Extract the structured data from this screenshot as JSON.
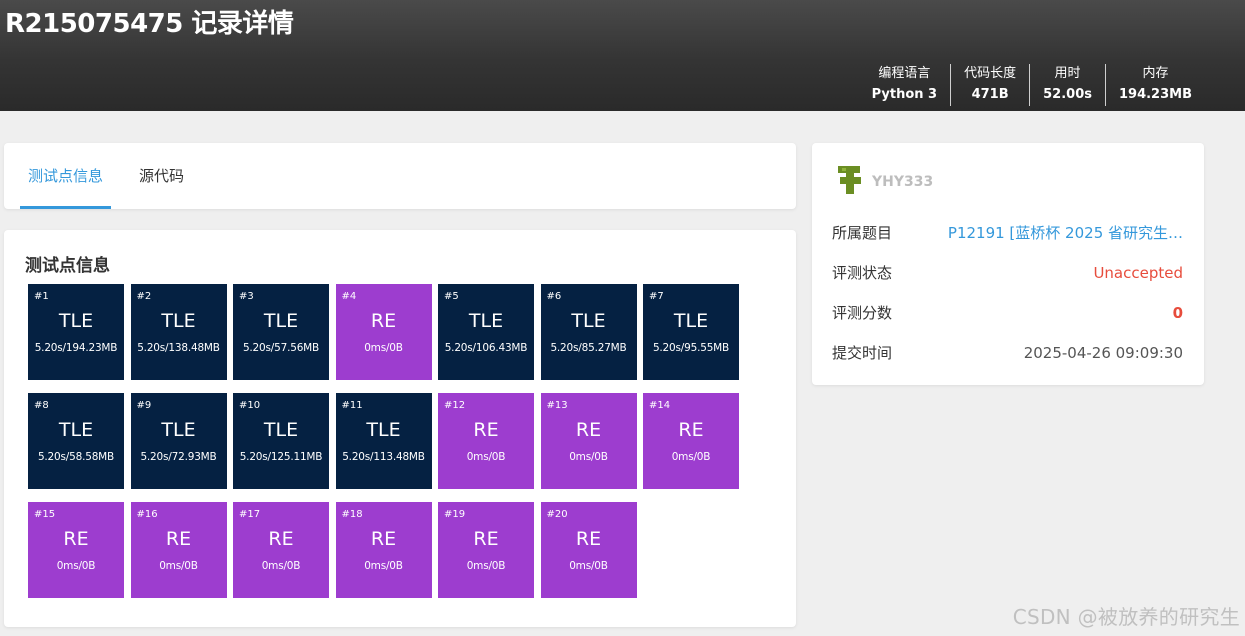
{
  "header": {
    "title": "R215075475 记录详情",
    "stats": [
      {
        "label": "编程语言",
        "value": "Python 3"
      },
      {
        "label": "代码长度",
        "value": "471B"
      },
      {
        "label": "用时",
        "value": "52.00s"
      },
      {
        "label": "内存",
        "value": "194.23MB"
      }
    ]
  },
  "tabs": [
    {
      "label": "测试点信息",
      "active": true
    },
    {
      "label": "源代码",
      "active": false
    }
  ],
  "tests": {
    "title": "测试点信息",
    "colors": {
      "TLE": "#052142",
      "RE": "#9d3dcf"
    },
    "items": [
      {
        "id": "#1",
        "status": "TLE",
        "detail": "5.20s/194.23MB"
      },
      {
        "id": "#2",
        "status": "TLE",
        "detail": "5.20s/138.48MB"
      },
      {
        "id": "#3",
        "status": "TLE",
        "detail": "5.20s/57.56MB"
      },
      {
        "id": "#4",
        "status": "RE",
        "detail": "0ms/0B"
      },
      {
        "id": "#5",
        "status": "TLE",
        "detail": "5.20s/106.43MB"
      },
      {
        "id": "#6",
        "status": "TLE",
        "detail": "5.20s/85.27MB"
      },
      {
        "id": "#7",
        "status": "TLE",
        "detail": "5.20s/95.55MB"
      },
      {
        "id": "#8",
        "status": "TLE",
        "detail": "5.20s/58.58MB"
      },
      {
        "id": "#9",
        "status": "TLE",
        "detail": "5.20s/72.93MB"
      },
      {
        "id": "#10",
        "status": "TLE",
        "detail": "5.20s/125.11MB"
      },
      {
        "id": "#11",
        "status": "TLE",
        "detail": "5.20s/113.48MB"
      },
      {
        "id": "#12",
        "status": "RE",
        "detail": "0ms/0B"
      },
      {
        "id": "#13",
        "status": "RE",
        "detail": "0ms/0B"
      },
      {
        "id": "#14",
        "status": "RE",
        "detail": "0ms/0B"
      },
      {
        "id": "#15",
        "status": "RE",
        "detail": "0ms/0B"
      },
      {
        "id": "#16",
        "status": "RE",
        "detail": "0ms/0B"
      },
      {
        "id": "#17",
        "status": "RE",
        "detail": "0ms/0B"
      },
      {
        "id": "#18",
        "status": "RE",
        "detail": "0ms/0B"
      },
      {
        "id": "#19",
        "status": "RE",
        "detail": "0ms/0B"
      },
      {
        "id": "#20",
        "status": "RE",
        "detail": "0ms/0B"
      }
    ]
  },
  "info": {
    "user": {
      "name": "YHY333",
      "icon": "user-avatar-icon",
      "icon_color": "#6b8e23"
    },
    "rows": [
      {
        "label": "所属题目",
        "value": "P12191 [蓝桥杯 2025 省研究生…",
        "style": "link"
      },
      {
        "label": "评测状态",
        "value": "Unaccepted",
        "style": "err"
      },
      {
        "label": "评测分数",
        "value": "0",
        "style": "score"
      },
      {
        "label": "提交时间",
        "value": "2025-04-26 09:09:30",
        "style": "plain"
      }
    ]
  },
  "watermark": "CSDN @被放养的研究生"
}
